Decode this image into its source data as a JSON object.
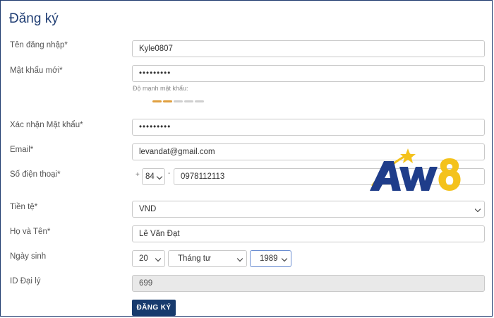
{
  "form": {
    "title": "Đăng ký",
    "username": {
      "label": "Tên đăng nhập*",
      "value": "Kyle0807"
    },
    "password": {
      "label": "Mật khẩu mới*",
      "value": "•••••••••"
    },
    "strength": {
      "label": "Độ mạnh mật khẩu:",
      "level": 0.4,
      "active_color": "#e0a040",
      "inactive_color": "#cfcfcf"
    },
    "confirm": {
      "label": "Xác nhận Mật khẩu*",
      "value": "•••••••••"
    },
    "email": {
      "label": "Email*",
      "value": "levandat@gmail.com"
    },
    "phone": {
      "label": "Số điện thoại*",
      "plus": "+",
      "code": "84",
      "dash": "-",
      "value": "0978112113"
    },
    "currency": {
      "label": "Tiền tệ*",
      "value": "VND"
    },
    "fullname": {
      "label": "Họ và Tên*",
      "value": "Lê Văn Đạt"
    },
    "birthday": {
      "label": "Ngày sinh",
      "day": "20",
      "month": "Tháng tư",
      "year": "1989"
    },
    "agent": {
      "label": "ID Đại lý",
      "value": "699"
    },
    "submit_label": "ĐĂNG KÝ"
  },
  "logo": {
    "text": "AW8",
    "icon": "star-icon",
    "primary_color": "#1f3d8a",
    "accent_color": "#f4c21c"
  },
  "colors": {
    "frame": "#1e3a6e",
    "title": "#1f3d73",
    "button": "#173a6d"
  }
}
